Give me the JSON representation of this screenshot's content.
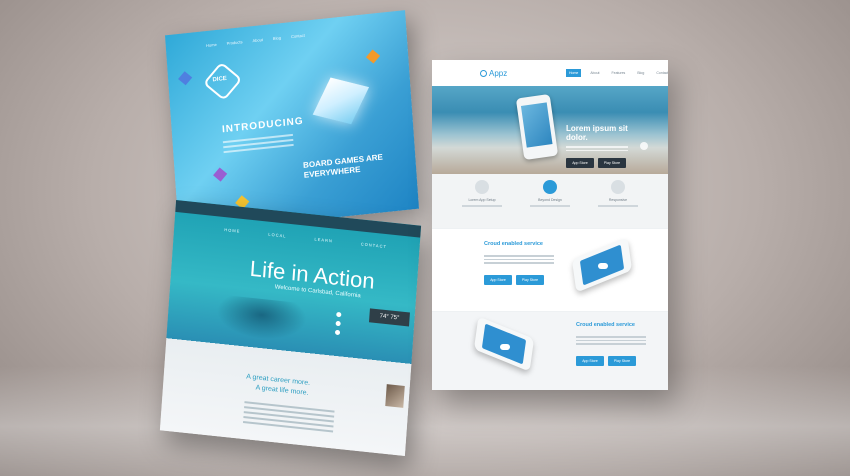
{
  "left_back_site": {
    "nav": [
      "Home",
      "Products",
      "About",
      "Blog",
      "Contact"
    ],
    "logo": "DICE",
    "heading": "INTRODUCING",
    "secondary_heading": "BOARD GAMES ARE EVERYWHERE"
  },
  "left_front_site": {
    "nav": [
      "HOME",
      "LOCAL",
      "LEARN",
      "CONTACT"
    ],
    "hero_title": "Life in Action",
    "hero_subtitle": "Welcome to Carlsbad, California",
    "weather": "74° 75°",
    "quote_line1": "A great career more.",
    "quote_line2": "A great life more."
  },
  "right_site": {
    "logo": "Appz",
    "nav": [
      "Home",
      "About",
      "Features",
      "Blog",
      "Contact"
    ],
    "hero_title": "Lorem ipsum sit dolor.",
    "store_buttons": [
      "App Store",
      "Play Store"
    ],
    "features": [
      "Lorem App Setup",
      "Beyond Design",
      "Responsive"
    ],
    "section1_title": "Croud enabled service",
    "section2_title": "Croud enabled service"
  },
  "colors": {
    "accent_blue": "#2b9ad8",
    "teal": "#1c9fb2",
    "dark": "#20495a"
  }
}
